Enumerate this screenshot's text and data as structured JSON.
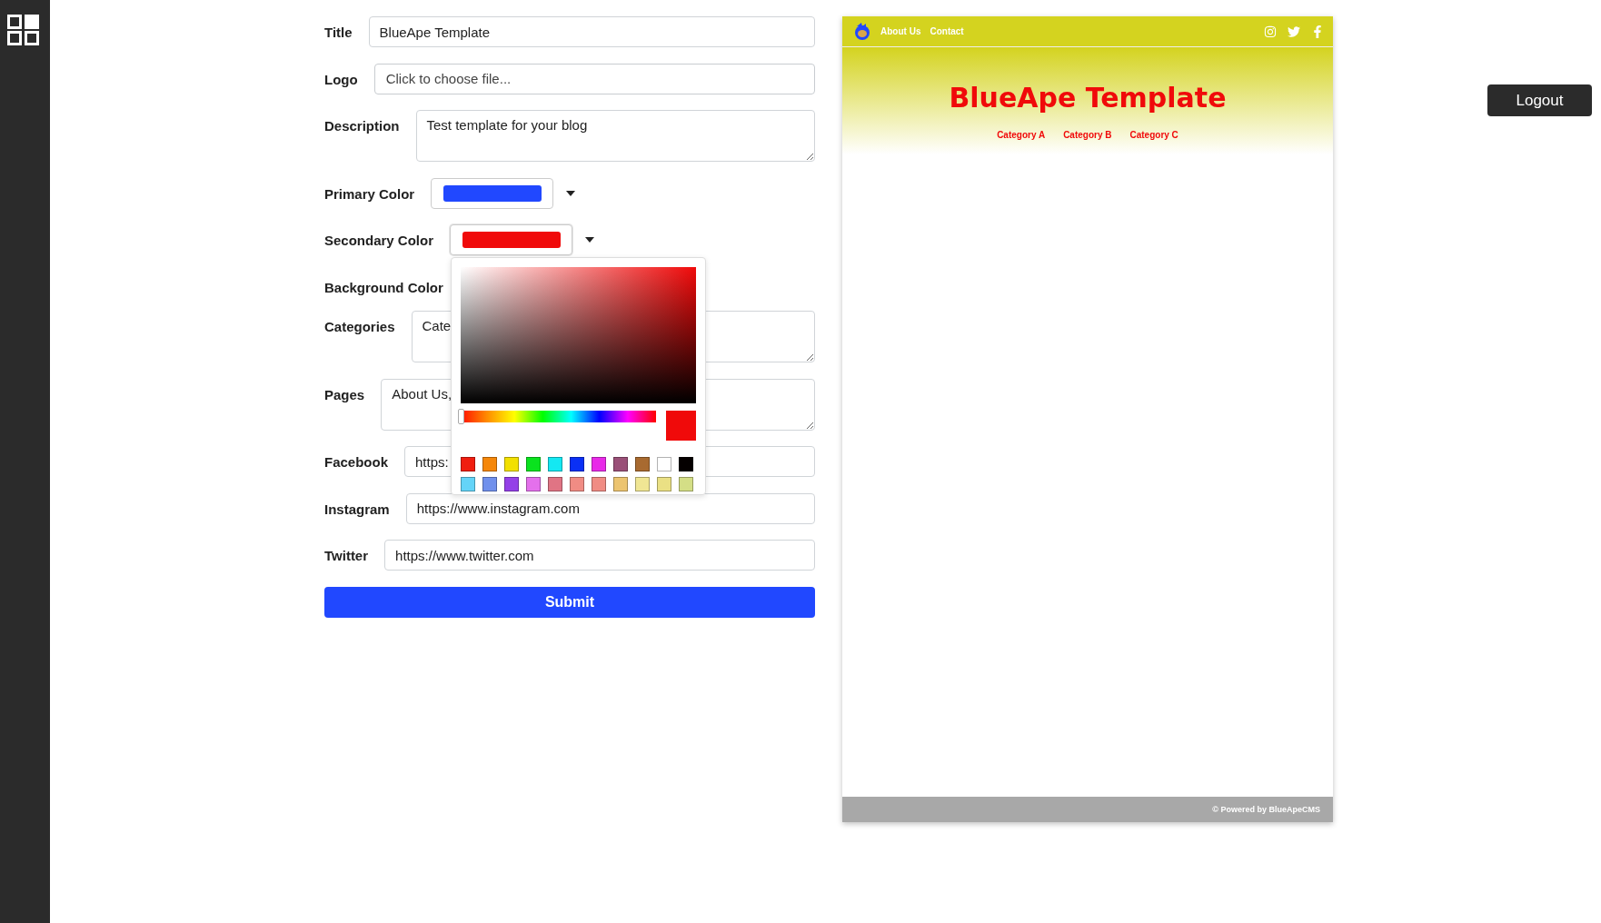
{
  "form": {
    "fields": [
      {
        "kind": "text",
        "label": "Title",
        "value": "BlueApe Template"
      },
      {
        "kind": "file",
        "label": "Logo",
        "placeholder": "Click to choose file..."
      },
      {
        "kind": "textarea",
        "label": "Description",
        "value": "Test template for your blog"
      },
      {
        "kind": "color",
        "label": "Primary Color",
        "color": "#2148ff",
        "picker_open": false
      },
      {
        "kind": "color",
        "label": "Secondary Color",
        "color": "#f00a0a",
        "picker_open": true
      },
      {
        "kind": "hidden",
        "label": "Background Color"
      },
      {
        "kind": "textarea",
        "label": "Categories",
        "value": "Cate"
      },
      {
        "kind": "textarea",
        "label": "Pages",
        "value": "About Us,"
      },
      {
        "kind": "text",
        "label": "Facebook",
        "value": "https:"
      },
      {
        "kind": "text",
        "label": "Instagram",
        "value": "https://www.instagram.com"
      },
      {
        "kind": "text",
        "label": "Twitter",
        "value": "https://www.twitter.com"
      }
    ],
    "submit": "Submit"
  },
  "color_picker": {
    "hue": {
      "level": 0
    },
    "swatches": [
      {
        "color": "#f01e10"
      },
      {
        "color": "#f5870a"
      },
      {
        "color": "#f2e000"
      },
      {
        "color": "#0ae21e"
      },
      {
        "color": "#14e8f2"
      },
      {
        "color": "#0a30f5"
      },
      {
        "color": "#e82ae8"
      },
      {
        "color": "#9a5078"
      },
      {
        "color": "#a86a30"
      },
      {
        "color": "#ffffff"
      },
      {
        "color": "#050000"
      },
      {
        "color": "#64d4f8"
      },
      {
        "color": "#7090ec"
      },
      {
        "color": "#9440e8"
      },
      {
        "color": "#e470ec"
      },
      {
        "color": "#e07484"
      },
      {
        "color": "#f08c84"
      },
      {
        "color": "#f08c84"
      },
      {
        "color": "#ecc470"
      },
      {
        "color": "#f0e694"
      },
      {
        "color": "#eae084"
      },
      {
        "color": "#d4de86"
      }
    ]
  },
  "preview": {
    "nav": [
      "About Us",
      "Contact"
    ],
    "title": "BlueApe Template",
    "categories": [
      "Category A",
      "Category B",
      "Category C"
    ],
    "footer": "© Powered by BlueApeCMS"
  },
  "logout": "Logout"
}
